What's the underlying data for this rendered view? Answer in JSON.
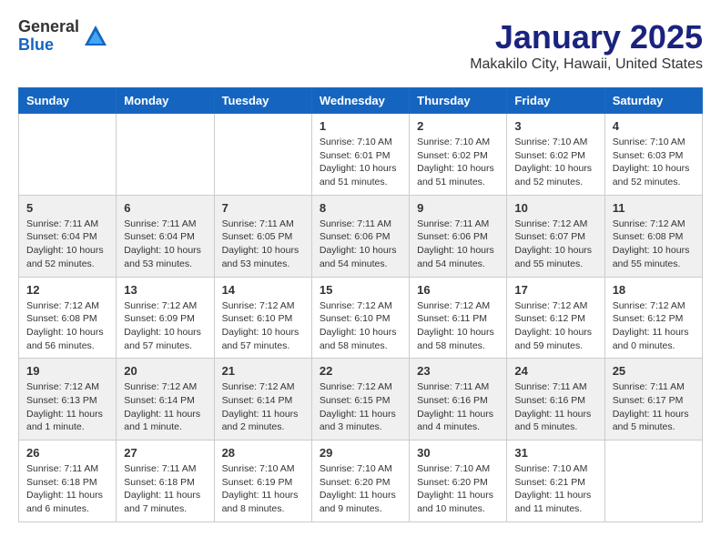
{
  "header": {
    "logo_general": "General",
    "logo_blue": "Blue",
    "month_title": "January 2025",
    "location": "Makakilo City, Hawaii, United States"
  },
  "weekdays": [
    "Sunday",
    "Monday",
    "Tuesday",
    "Wednesday",
    "Thursday",
    "Friday",
    "Saturday"
  ],
  "weeks": [
    [
      {
        "day": "",
        "info": ""
      },
      {
        "day": "",
        "info": ""
      },
      {
        "day": "",
        "info": ""
      },
      {
        "day": "1",
        "info": "Sunrise: 7:10 AM\nSunset: 6:01 PM\nDaylight: 10 hours\nand 51 minutes."
      },
      {
        "day": "2",
        "info": "Sunrise: 7:10 AM\nSunset: 6:02 PM\nDaylight: 10 hours\nand 51 minutes."
      },
      {
        "day": "3",
        "info": "Sunrise: 7:10 AM\nSunset: 6:02 PM\nDaylight: 10 hours\nand 52 minutes."
      },
      {
        "day": "4",
        "info": "Sunrise: 7:10 AM\nSunset: 6:03 PM\nDaylight: 10 hours\nand 52 minutes."
      }
    ],
    [
      {
        "day": "5",
        "info": "Sunrise: 7:11 AM\nSunset: 6:04 PM\nDaylight: 10 hours\nand 52 minutes."
      },
      {
        "day": "6",
        "info": "Sunrise: 7:11 AM\nSunset: 6:04 PM\nDaylight: 10 hours\nand 53 minutes."
      },
      {
        "day": "7",
        "info": "Sunrise: 7:11 AM\nSunset: 6:05 PM\nDaylight: 10 hours\nand 53 minutes."
      },
      {
        "day": "8",
        "info": "Sunrise: 7:11 AM\nSunset: 6:06 PM\nDaylight: 10 hours\nand 54 minutes."
      },
      {
        "day": "9",
        "info": "Sunrise: 7:11 AM\nSunset: 6:06 PM\nDaylight: 10 hours\nand 54 minutes."
      },
      {
        "day": "10",
        "info": "Sunrise: 7:12 AM\nSunset: 6:07 PM\nDaylight: 10 hours\nand 55 minutes."
      },
      {
        "day": "11",
        "info": "Sunrise: 7:12 AM\nSunset: 6:08 PM\nDaylight: 10 hours\nand 55 minutes."
      }
    ],
    [
      {
        "day": "12",
        "info": "Sunrise: 7:12 AM\nSunset: 6:08 PM\nDaylight: 10 hours\nand 56 minutes."
      },
      {
        "day": "13",
        "info": "Sunrise: 7:12 AM\nSunset: 6:09 PM\nDaylight: 10 hours\nand 57 minutes."
      },
      {
        "day": "14",
        "info": "Sunrise: 7:12 AM\nSunset: 6:10 PM\nDaylight: 10 hours\nand 57 minutes."
      },
      {
        "day": "15",
        "info": "Sunrise: 7:12 AM\nSunset: 6:10 PM\nDaylight: 10 hours\nand 58 minutes."
      },
      {
        "day": "16",
        "info": "Sunrise: 7:12 AM\nSunset: 6:11 PM\nDaylight: 10 hours\nand 58 minutes."
      },
      {
        "day": "17",
        "info": "Sunrise: 7:12 AM\nSunset: 6:12 PM\nDaylight: 10 hours\nand 59 minutes."
      },
      {
        "day": "18",
        "info": "Sunrise: 7:12 AM\nSunset: 6:12 PM\nDaylight: 11 hours\nand 0 minutes."
      }
    ],
    [
      {
        "day": "19",
        "info": "Sunrise: 7:12 AM\nSunset: 6:13 PM\nDaylight: 11 hours\nand 1 minute."
      },
      {
        "day": "20",
        "info": "Sunrise: 7:12 AM\nSunset: 6:14 PM\nDaylight: 11 hours\nand 1 minute."
      },
      {
        "day": "21",
        "info": "Sunrise: 7:12 AM\nSunset: 6:14 PM\nDaylight: 11 hours\nand 2 minutes."
      },
      {
        "day": "22",
        "info": "Sunrise: 7:12 AM\nSunset: 6:15 PM\nDaylight: 11 hours\nand 3 minutes."
      },
      {
        "day": "23",
        "info": "Sunrise: 7:11 AM\nSunset: 6:16 PM\nDaylight: 11 hours\nand 4 minutes."
      },
      {
        "day": "24",
        "info": "Sunrise: 7:11 AM\nSunset: 6:16 PM\nDaylight: 11 hours\nand 5 minutes."
      },
      {
        "day": "25",
        "info": "Sunrise: 7:11 AM\nSunset: 6:17 PM\nDaylight: 11 hours\nand 5 minutes."
      }
    ],
    [
      {
        "day": "26",
        "info": "Sunrise: 7:11 AM\nSunset: 6:18 PM\nDaylight: 11 hours\nand 6 minutes."
      },
      {
        "day": "27",
        "info": "Sunrise: 7:11 AM\nSunset: 6:18 PM\nDaylight: 11 hours\nand 7 minutes."
      },
      {
        "day": "28",
        "info": "Sunrise: 7:10 AM\nSunset: 6:19 PM\nDaylight: 11 hours\nand 8 minutes."
      },
      {
        "day": "29",
        "info": "Sunrise: 7:10 AM\nSunset: 6:20 PM\nDaylight: 11 hours\nand 9 minutes."
      },
      {
        "day": "30",
        "info": "Sunrise: 7:10 AM\nSunset: 6:20 PM\nDaylight: 11 hours\nand 10 minutes."
      },
      {
        "day": "31",
        "info": "Sunrise: 7:10 AM\nSunset: 6:21 PM\nDaylight: 11 hours\nand 11 minutes."
      },
      {
        "day": "",
        "info": ""
      }
    ]
  ]
}
